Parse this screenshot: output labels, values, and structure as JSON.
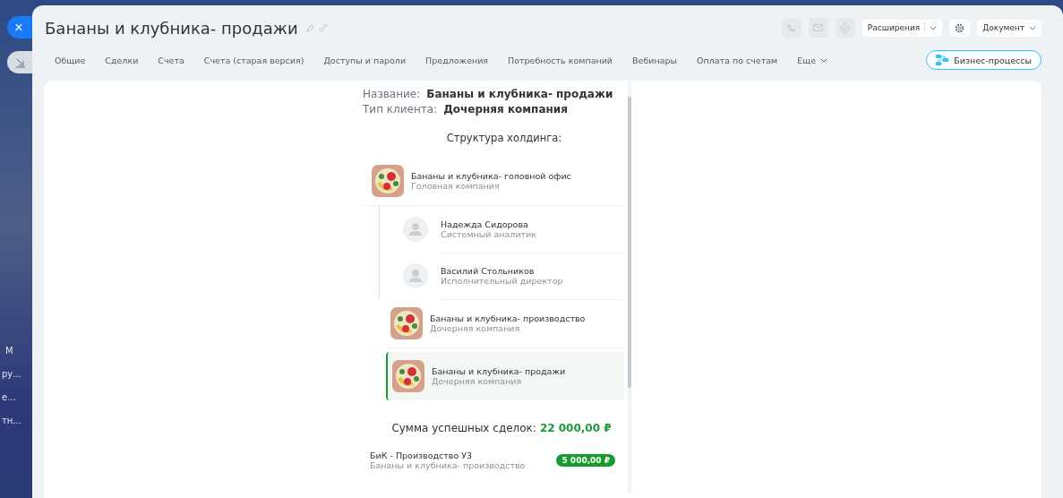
{
  "backdrop": {
    "sidebar_fragments": [
      "М",
      "ру...",
      "е...",
      "тн..."
    ]
  },
  "side_buttons": [
    {
      "kind": "close",
      "label": "×"
    },
    {
      "kind": "minimize"
    }
  ],
  "window": {
    "title": "Бананы и клубника- продажи"
  },
  "header_actions": {
    "extensions": "Расширения",
    "document": "Документ"
  },
  "tabs": [
    {
      "label": "Общие",
      "selected": false
    },
    {
      "label": "Сделки",
      "selected": false
    },
    {
      "label": "Счета",
      "selected": false
    },
    {
      "label": "Счета (старая версия)",
      "selected": false
    },
    {
      "label": "Доступы и пароли",
      "selected": false
    },
    {
      "label": "Предложения",
      "selected": false
    },
    {
      "label": "Потребность компаний",
      "selected": false
    },
    {
      "label": "Вебинары",
      "selected": false
    },
    {
      "label": "Оплата по счетам",
      "selected": false
    },
    {
      "label": "Еще",
      "selected": false,
      "kind": "more"
    }
  ],
  "business_process_button": "Бизнес-процессы",
  "fields": [
    {
      "label": "Название:",
      "value": "Бананы и клубника- продажи"
    },
    {
      "label": "Тип клиента:",
      "value": "Дочерняя компания"
    }
  ],
  "structure": {
    "title": "Структура холдинга:",
    "items": [
      {
        "name": "Бананы и клубника- головной офис",
        "role": "Головная компания",
        "selected": false,
        "children": [
          {
            "name": "Надежда Сидорова",
            "role": "Системный аналитик"
          },
          {
            "name": "Василий Стольников",
            "role": "Исполнительный директор"
          }
        ]
      },
      {
        "name": "Бананы и клубника- производство",
        "role": "Дочерняя компания",
        "selected": false
      },
      {
        "name": "Бананы и клубника- продажи",
        "role": "Дочерняя компания",
        "selected": true
      }
    ]
  },
  "deals": {
    "label": "Сумма успешных сделок:",
    "total": "22 000,00 ₽",
    "rows": [
      {
        "title": "БиК - Производство У3",
        "company": "Бананы и клубника- производство",
        "amount": "5 000,00 ₽"
      }
    ]
  }
}
